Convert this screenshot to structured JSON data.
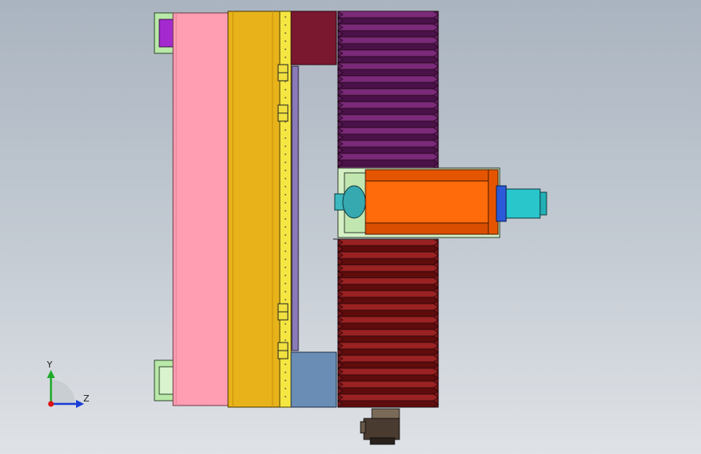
{
  "viewport": {
    "background_top": "#aab4c0",
    "background_bottom": "#dfe2e6"
  },
  "colors": {
    "pink_plate": "#ff9db3",
    "yellow_beam": "#e8b31a",
    "maroon_block": "#7a1830",
    "purple_bellows": "#5c1b5c",
    "red_bellows": "#7a1414",
    "orange_spindle": "#ff6a0a",
    "cyan_motor": "#29c6cc",
    "blue_block": "#6a8db5",
    "flange_green": "#b9e8a8",
    "flange_magenta": "#a42ad0",
    "rack_strip": "#f5e642"
  },
  "parts": [
    {
      "name": "left-flange-top",
      "icon": "flange-icon"
    },
    {
      "name": "left-flange-bottom",
      "icon": "flange-icon"
    },
    {
      "name": "pink-plate",
      "icon": "plate-icon"
    },
    {
      "name": "yellow-beam",
      "icon": "beam-icon"
    },
    {
      "name": "rack-strip",
      "icon": "rack-icon"
    },
    {
      "name": "maroon-block",
      "icon": "block-icon"
    },
    {
      "name": "purple-bellows",
      "icon": "bellows-icon"
    },
    {
      "name": "red-bellows",
      "icon": "bellows-icon"
    },
    {
      "name": "spindle-housing",
      "icon": "spindle-icon"
    },
    {
      "name": "spindle-motor",
      "icon": "motor-icon"
    },
    {
      "name": "blue-block",
      "icon": "block-icon"
    },
    {
      "name": "bottom-motor",
      "icon": "motor-icon"
    }
  ],
  "triad": {
    "y_label": "Y",
    "z_label": "Z",
    "y_color": "#1faa2a",
    "z_color": "#1a3fd6",
    "x_color": "#e01010"
  }
}
